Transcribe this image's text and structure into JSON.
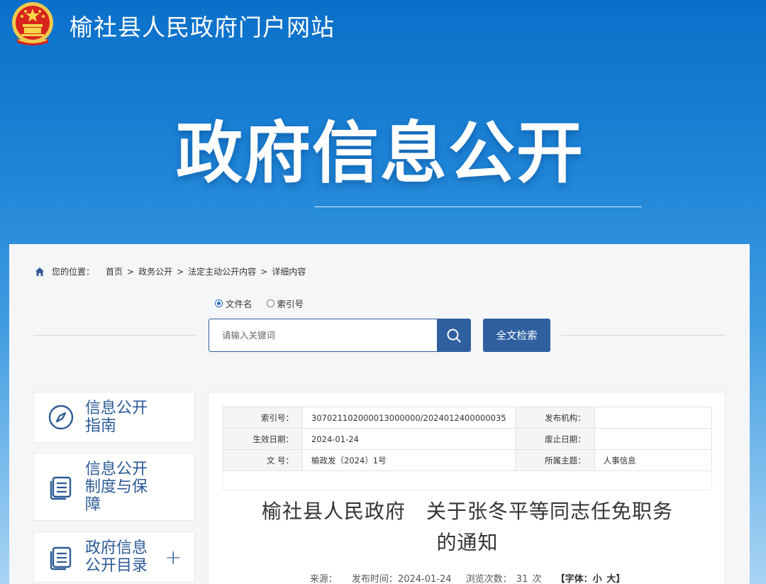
{
  "header": {
    "site_title": "榆社县人民政府门户网站",
    "banner_title": "政府信息公开",
    "colors": {
      "primary": "#0a6fc9",
      "accent_button": "#2f5f9f",
      "sidebar_text": "#2b5a96"
    }
  },
  "breadcrumb": {
    "prefix": "您的位置：",
    "items": [
      "首页",
      "政务公开",
      "法定主动公开内容",
      "详细内容"
    ],
    "separator": ">"
  },
  "search": {
    "options": [
      {
        "label": "文件名",
        "selected": true
      },
      {
        "label": "索引号",
        "selected": false
      }
    ],
    "placeholder": "请输入关键词",
    "fulltext_button": "全文检索"
  },
  "sidebar": {
    "items": [
      {
        "label": "信息公开指南",
        "icon": "compass-icon"
      },
      {
        "label": "信息公开制度与保障",
        "icon": "document-list-icon"
      },
      {
        "label": "政府信息公开目录",
        "icon": "document-list-icon",
        "expand": "+"
      }
    ]
  },
  "document": {
    "meta": {
      "index_label": "索引号：",
      "index_value": "307021102000013000000/2024012400000035",
      "publisher_label": "发布机构：",
      "publisher_value": "",
      "effective_label": "生效日期：",
      "effective_value": "2024-01-24",
      "expire_label": "废止日期：",
      "expire_value": "",
      "docno_label": "文 号：",
      "docno_value": "榆政发〔2024〕1号",
      "topic_label": "所属主题：",
      "topic_value": "人事信息"
    },
    "title_line1": "榆社县人民政府　关于张冬平等同志任免职务",
    "title_line2": "的通知",
    "info": {
      "source_label": "来源：",
      "source_value": "",
      "date_label": "发布时间：",
      "date_value": "2024-01-24",
      "views_label": "浏览次数：",
      "views_value": "31",
      "views_unit": "次",
      "font_label": "【字体：",
      "font_small": "小",
      "font_large": "大",
      "font_close": "】"
    }
  }
}
